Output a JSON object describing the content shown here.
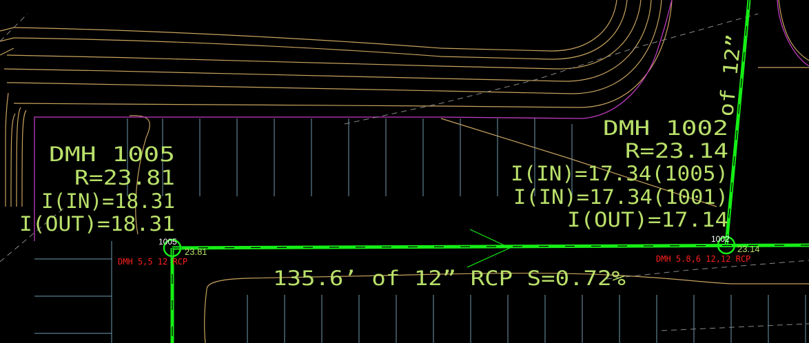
{
  "colors": {
    "background": "#000000",
    "pipe": "#16ee16",
    "contour": "#c9a45f",
    "boundary": "#c23bc2",
    "parking": "#6f9bb0",
    "label": "#b9e06a",
    "structure_tag": "#ff2020",
    "node_label": "#ffffff",
    "hidden": "#8a8a8a"
  },
  "manholes": {
    "dmh1005": {
      "name": "DMH 1005",
      "rim": "R=23.81",
      "inv_in": "I(IN)=18.31",
      "inv_out": "I(OUT)=18.31",
      "node_id": "1005",
      "node_elev": "23.81",
      "tag": "DMH 5,5 12 RCP"
    },
    "dmh1002": {
      "name": "DMH 1002",
      "rim": "R=23.14",
      "inv_in_1": "I(IN)=17.34(1005)",
      "inv_in_2": "I(IN)=17.34(1001)",
      "inv_out": "I(OUT)=17.14",
      "node_id": "1002",
      "node_elev": "23.14",
      "tag": "DMH 5.8,6 12,12 RCP"
    }
  },
  "pipes": {
    "horizontal": "135.6’ of 12” RCP S=0.72%",
    "vertical_partial": "of 12”"
  }
}
